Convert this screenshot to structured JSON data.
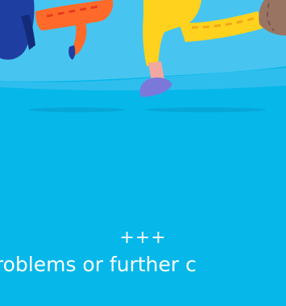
{
  "hero": {
    "illustration": "running-people-illustration"
  },
  "content": {
    "separator": "+++",
    "partial_text": "problems or further c"
  },
  "colors": {
    "background": "#06b7ea",
    "text": "#ffffff"
  }
}
